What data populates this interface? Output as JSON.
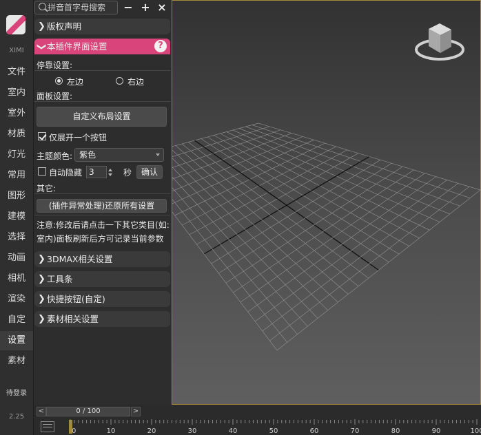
{
  "sidebar": {
    "brand": "XIMI",
    "categories": [
      "文件",
      "室内",
      "室外",
      "材质",
      "灯光",
      "常用",
      "图形",
      "建模",
      "选择",
      "动画",
      "相机",
      "渲染",
      "自定",
      "设置",
      "素材"
    ],
    "active_index": 13,
    "login": "待登录",
    "version": "2.25"
  },
  "search": {
    "placeholder": "拼音首字母搜索",
    "minimize": "−",
    "add": "+",
    "close": "×"
  },
  "sections": {
    "copyright": "版权声明",
    "panel_settings": "本插件界面设置",
    "help": "?",
    "max_settings": "3DMAX相关设置",
    "toolbar": "工具条",
    "quick_buttons": "快捷按钮(自定)",
    "material_settings": "素材相关设置"
  },
  "settings": {
    "dock_label": "停靠设置:",
    "dock_left": "左边",
    "dock_right": "右边",
    "dock_selected": "left",
    "panel_label": "面板设置:",
    "custom_layout_button": "自定义布局设置",
    "expand_one_label": "仅展开一个按钮",
    "expand_one_checked": true,
    "theme_label": "主题颜色:",
    "theme_value": "紫色",
    "autohide_label": "自动隐藏",
    "autohide_checked": false,
    "autohide_seconds": "3",
    "seconds_unit": "秒",
    "confirm_button": "确认",
    "other_label": "其它:",
    "restore_button": "(插件异常处理)还原所有设置",
    "note_line1": "注意:修改后请点击一下其它类目(如:",
    "note_line2": "室内)面板刷新后方可记录当前参数"
  },
  "timeline": {
    "left_arrow": "<",
    "slider_text": "0 / 100",
    "right_arrow": ">",
    "ticks": [
      "0",
      "10",
      "20",
      "30",
      "40",
      "50",
      "60",
      "70",
      "80",
      "90",
      "100"
    ]
  }
}
